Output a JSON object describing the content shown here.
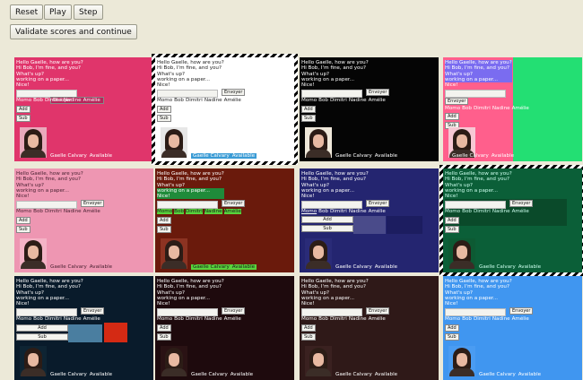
{
  "toolbar": {
    "reset_label": "Reset",
    "play_label": "Play",
    "step_label": "Step",
    "validate_label": "Validate scores and continue"
  },
  "chat": {
    "messages": [
      "Hello Gaelle, how are you?",
      "Hi Bob, I'm fine, and you?",
      "What's up?",
      "working on a paper...",
      "Nice!"
    ],
    "send_label": "Envoyer",
    "users": [
      "Momo",
      "Bob",
      "Dimitri",
      "Nadine",
      "Amélie"
    ],
    "add_label": "Add",
    "sub_label": "Sub",
    "contact_name": "Gaelle Calvary",
    "contact_status": "Available"
  },
  "colors": {
    "c0": "#e0356b",
    "c1": "#ffffff",
    "c2": "#050505",
    "c3": "#23df73",
    "c4": "#ee96b2",
    "c5": "#6a1a0c",
    "c6": "#242570",
    "c7": "#0b5f38",
    "c8": "#091b2b",
    "c9": "#1e0a0d",
    "c10": "#2f1918",
    "c11": "#4096f0"
  }
}
